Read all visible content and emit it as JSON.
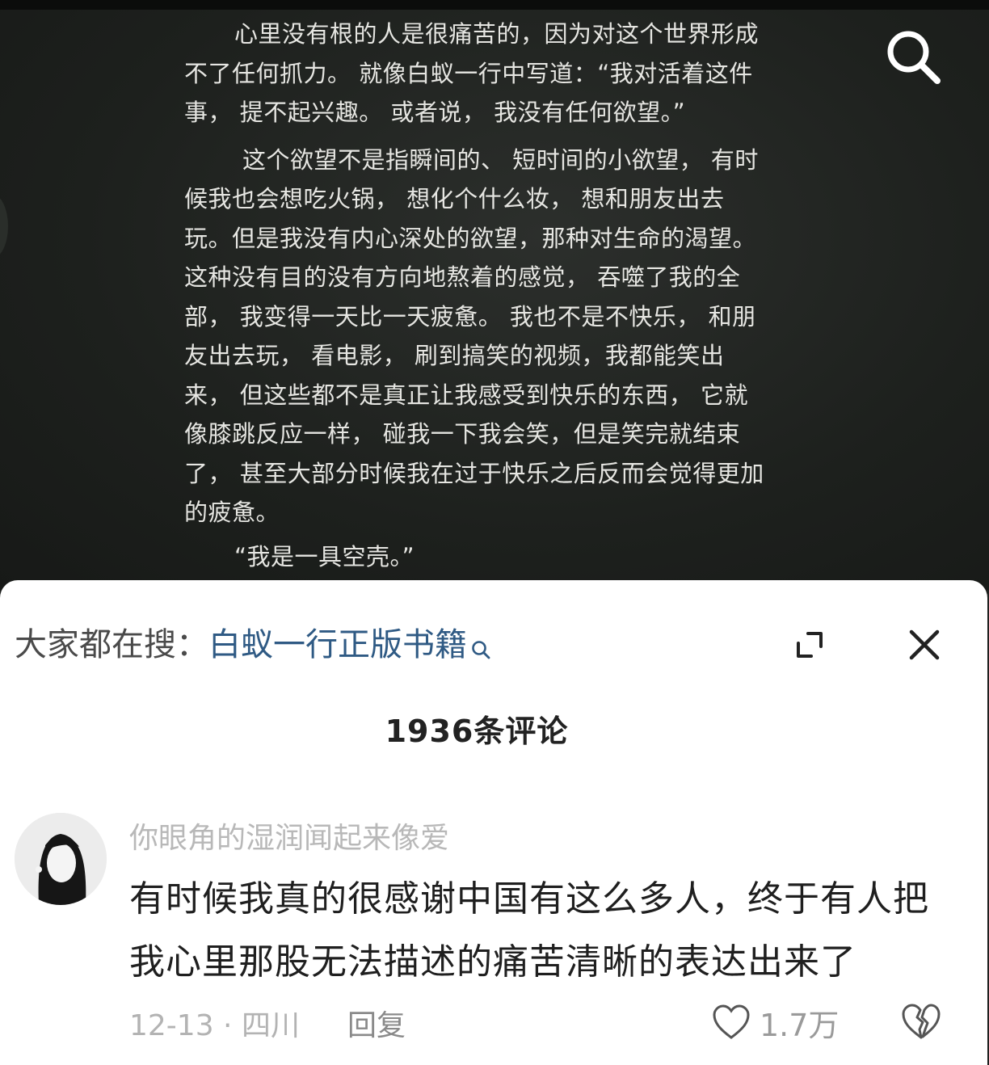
{
  "page_text": {
    "para1": "心里没有根的人是很痛苦的，因为对这个世界形成不了任何抓力。 就像白蚁一行中写道：“我对活着这件事， 提不起兴趣。 或者说， 我没有任何欲望。”",
    "para2": "这个欲望不是指瞬间的、 短时间的小欲望， 有时候我也会想吃火锅， 想化个什么妆， 想和朋友出去玩。但是我没有内心深处的欲望，那种对生命的渴望。这种没有目的没有方向地熬着的感觉， 吞噬了我的全部， 我变得一天比一天疲惫。 我也不是不快乐， 和朋友出去玩， 看电影， 刷到搞笑的视频，我都能笑出来， 但这些都不是真正让我感受到快乐的东西， 它就像膝跳反应一样， 碰我一下我会笑，但是笑完就结束了， 甚至大部分时候我在过于快乐之后反而会觉得更加的疲惫。",
    "para3": "“我是一具空壳。”"
  },
  "hot_search": {
    "label": "大家都在搜：",
    "term": "白蚁一行正版书籍"
  },
  "comments_header": {
    "count_text": "1936条评论"
  },
  "comment": {
    "username": "你眼角的湿润闻起来像爱",
    "text": "有时候我真的很感谢中国有这么多人，终于有人把我心里那股无法描述的痛苦清晰的表达出来了",
    "date_location": "12-13 · 四川",
    "reply_label": "回复",
    "like_count": "1.7万"
  },
  "icons": {
    "search": "search-icon",
    "magnifier": "magnifier-small-icon",
    "expand": "expand-icon",
    "close": "close-icon",
    "heart": "heart-outline-icon",
    "dislike": "broken-heart-icon"
  },
  "colors": {
    "media_bg": "#1f211f",
    "link_blue": "#2f5a84",
    "sheet_bg": "#ffffff"
  }
}
